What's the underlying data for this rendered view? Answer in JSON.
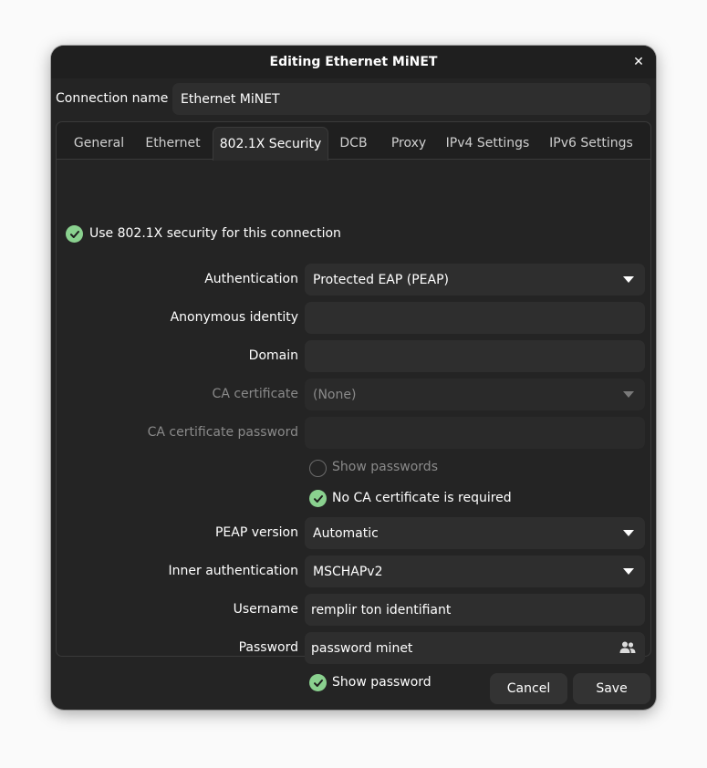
{
  "window": {
    "title": "Editing Ethernet MiNET"
  },
  "connection": {
    "label": "Connection name",
    "value": "Ethernet MiNET"
  },
  "tabs": [
    {
      "label": "General"
    },
    {
      "label": "Ethernet"
    },
    {
      "label": "802.1X Security"
    },
    {
      "label": "DCB"
    },
    {
      "label": "Proxy"
    },
    {
      "label": "IPv4 Settings"
    },
    {
      "label": "IPv6 Settings"
    }
  ],
  "active_tab": "802.1X Security",
  "security": {
    "use_8021x_label": "Use 802.1X security for this connection",
    "use_8021x_checked": true,
    "authentication": {
      "label": "Authentication",
      "value": "Protected EAP (PEAP)"
    },
    "anonymous_identity": {
      "label": "Anonymous identity",
      "value": ""
    },
    "domain": {
      "label": "Domain",
      "value": ""
    },
    "ca_certificate": {
      "label": "CA certificate",
      "value": "(None)"
    },
    "ca_certificate_password": {
      "label": "CA certificate password",
      "value": ""
    },
    "show_passwords": {
      "label": "Show passwords",
      "checked": false
    },
    "no_ca_required": {
      "label": "No CA certificate is required",
      "checked": true
    },
    "peap_version": {
      "label": "PEAP version",
      "value": "Automatic"
    },
    "inner_auth": {
      "label": "Inner authentication",
      "value": "MSCHAPv2"
    },
    "username": {
      "label": "Username",
      "value": "remplir ton identifiant"
    },
    "password": {
      "label": "Password",
      "value": "password minet"
    },
    "show_password": {
      "label": "Show password",
      "checked": true
    }
  },
  "buttons": {
    "cancel": "Cancel",
    "save": "Save"
  },
  "icons": {
    "close": "close-icon",
    "check": "check-icon",
    "password_storage": "users-icon",
    "dropdown": "dropdown-arrow-icon"
  },
  "colors": {
    "accent_check": "#8ad18f",
    "window_bg": "#242424"
  }
}
